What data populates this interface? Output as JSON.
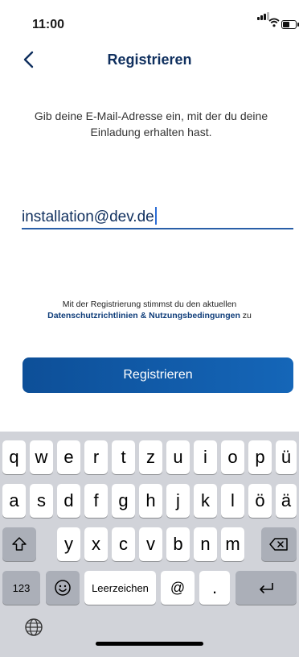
{
  "status_bar": {
    "time": "11:00"
  },
  "nav": {
    "title": "Registrieren",
    "back_icon": "chevron-left-icon"
  },
  "intro": {
    "text": "Gib deine E-Mail-Adresse ein, mit der du deine Einladung erhalten hast."
  },
  "email": {
    "value": "installation@dev.de"
  },
  "terms": {
    "prefix": "Mit der Registrierung stimmst du den aktuellen",
    "link": "Datenschutzrichtlinien & Nutzungsbedingungen",
    "suffix": "zu"
  },
  "register_button": {
    "label": "Registrieren"
  },
  "keyboard": {
    "row1": [
      "q",
      "w",
      "e",
      "r",
      "t",
      "z",
      "u",
      "i",
      "o",
      "p",
      "ü"
    ],
    "row2": [
      "a",
      "s",
      "d",
      "f",
      "g",
      "h",
      "j",
      "k",
      "l",
      "ö",
      "ä"
    ],
    "row3": [
      "y",
      "x",
      "c",
      "v",
      "b",
      "n",
      "m"
    ],
    "numbers_label": "123",
    "space_label": "Leerzeichen",
    "at_label": "@",
    "dot_label": "."
  },
  "colors": {
    "accent": "#0f2f5e",
    "button": "#1566b8",
    "link": "#0f3d7a",
    "keyboard_bg": "#d1d3d9"
  }
}
